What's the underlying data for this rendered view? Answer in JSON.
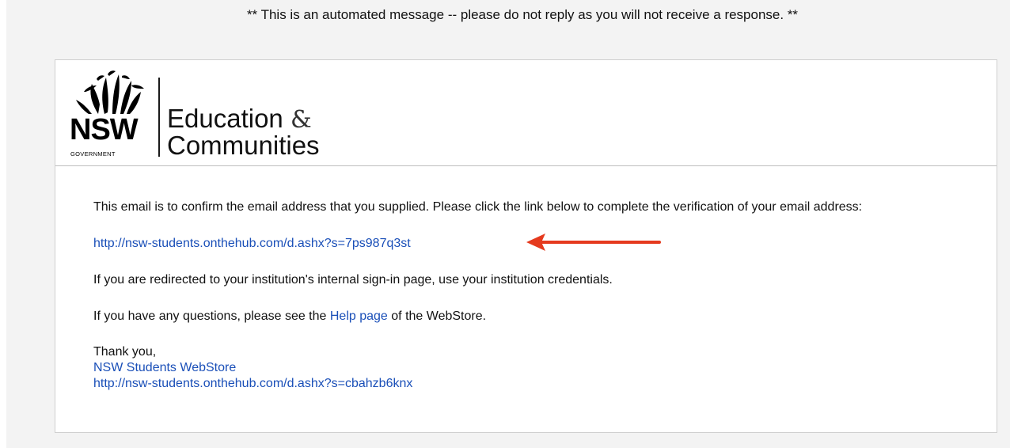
{
  "notice": "** This is an automated message -- please do not reply as you will not receive a response. **",
  "logo": {
    "nsw": "NSW",
    "government": "GOVERNMENT",
    "title_line1": "Education",
    "title_amp": "&",
    "title_line2": "Communities"
  },
  "email": {
    "intro": "This email is to confirm the email address that you supplied. Please click the link below to complete the verification of your email address:",
    "verify_url": "http://nsw-students.onthehub.com/d.ashx?s=7ps987q3st",
    "redirect_note": "If you are redirected to your institution's internal sign-in page, use your institution credentials.",
    "questions_prefix": "If you have any questions, please see the ",
    "help_link": "Help page",
    "questions_suffix": " of the WebStore.",
    "thanks": "Thank you,",
    "store_name": "NSW Students WebStore",
    "store_url": "http://nsw-students.onthehub.com/d.ashx?s=cbahzb6knx"
  },
  "colors": {
    "link": "#1a4fb8",
    "arrow": "#e53a1e",
    "page_background": "#f3f3f3"
  },
  "icons": {
    "logo": "waratah-logo-icon",
    "annotation": "red-arrow-icon"
  }
}
